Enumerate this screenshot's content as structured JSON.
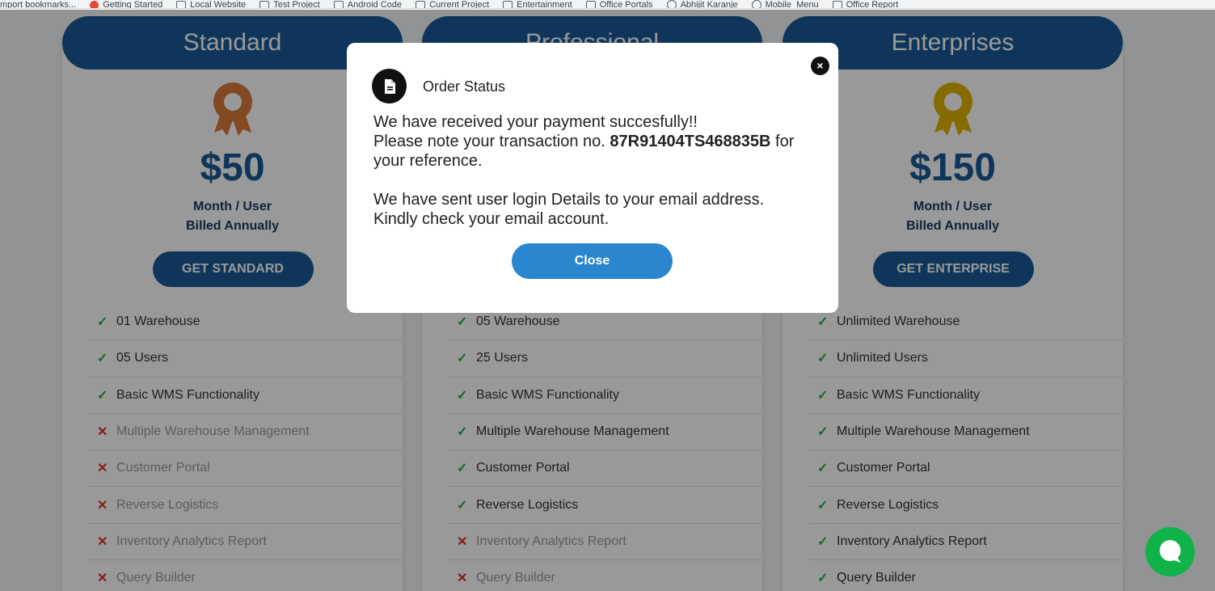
{
  "bookmarks": [
    {
      "label": "mport bookmarks...",
      "icon": "none"
    },
    {
      "label": "Getting Started",
      "icon": "firefox-icon"
    },
    {
      "label": "Local Website",
      "icon": "folder-icon"
    },
    {
      "label": "Test Project",
      "icon": "folder-icon"
    },
    {
      "label": "Android Code",
      "icon": "folder-icon"
    },
    {
      "label": "Current Project",
      "icon": "folder-icon"
    },
    {
      "label": "Entertainment",
      "icon": "folder-icon"
    },
    {
      "label": "Office Portals",
      "icon": "folder-icon"
    },
    {
      "label": "Abhijit Karanje",
      "icon": "globe-icon"
    },
    {
      "label": "Mobile_Menu",
      "icon": "globe-icon"
    },
    {
      "label": "Office Report",
      "icon": "folder-icon"
    }
  ],
  "plans": [
    {
      "name": "Standard",
      "price": "$50",
      "billing_line1": "Month / User",
      "billing_line2": "Billed Annually",
      "button": "GET STANDARD",
      "medal_color": "#d97b3a",
      "features": [
        {
          "text": "01 Warehouse",
          "included": true
        },
        {
          "text": "05 Users",
          "included": true
        },
        {
          "text": "Basic WMS Functionality",
          "included": true
        },
        {
          "text": "Multiple Warehouse Management",
          "included": false
        },
        {
          "text": "Customer Portal",
          "included": false
        },
        {
          "text": "Reverse Logistics",
          "included": false
        },
        {
          "text": "Inventory Analytics Report",
          "included": false
        },
        {
          "text": "Query Builder",
          "included": false
        }
      ]
    },
    {
      "name": "Professional",
      "price": "",
      "billing_line1": "",
      "billing_line2": "",
      "button": "",
      "medal_color": "#9aa5b1",
      "features": [
        {
          "text": "05 Warehouse",
          "included": true
        },
        {
          "text": "25 Users",
          "included": true
        },
        {
          "text": "Basic WMS Functionality",
          "included": true
        },
        {
          "text": "Multiple Warehouse Management",
          "included": true
        },
        {
          "text": "Customer Portal",
          "included": true
        },
        {
          "text": "Reverse Logistics",
          "included": true
        },
        {
          "text": "Inventory Analytics Report",
          "included": false
        },
        {
          "text": "Query Builder",
          "included": false
        }
      ]
    },
    {
      "name": "Enterprises",
      "price": "$150",
      "billing_line1": "Month / User",
      "billing_line2": "Billed Annually",
      "button": "GET ENTERPRISE",
      "medal_color": "#e0b300",
      "features": [
        {
          "text": "Unlimited Warehouse",
          "included": true
        },
        {
          "text": "Unlimited Users",
          "included": true
        },
        {
          "text": "Basic WMS Functionality",
          "included": true
        },
        {
          "text": "Multiple Warehouse Management",
          "included": true
        },
        {
          "text": "Customer Portal",
          "included": true
        },
        {
          "text": "Reverse Logistics",
          "included": true
        },
        {
          "text": "Inventory Analytics Report",
          "included": true
        },
        {
          "text": "Query Builder",
          "included": true
        }
      ]
    }
  ],
  "modal": {
    "title": "Order Status",
    "icon": "document-icon",
    "line1": "We have received your payment succesfully!!",
    "line2_prefix": "Please note your transaction no.",
    "transaction_no": "87R91404TS468835B",
    "line2_suffix": "for your reference.",
    "line3": "We have sent user login Details to your email address. Kindly check your email account.",
    "close_button": "Close",
    "close_icon": "×"
  },
  "colors": {
    "brand_blue": "#1a5a96",
    "close_button_blue": "#2a86cf",
    "check_green": "#2fa84f",
    "cross_red": "#e0302f",
    "chat_green": "#10b24a"
  },
  "chat_icon": "chat-bubble-icon"
}
